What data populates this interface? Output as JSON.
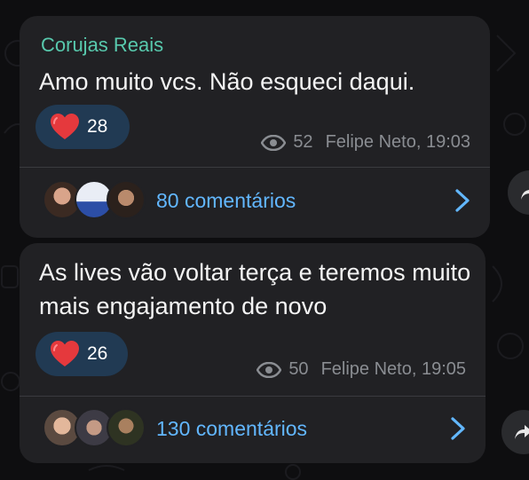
{
  "messages": [
    {
      "author": "Corujas Reais",
      "text": "Amo muito vcs. Não esqueci daqui.",
      "reaction": {
        "icon": "heart-icon",
        "count": "28"
      },
      "views": "52",
      "signature": "Felipe Neto, 19:03",
      "comments_label": "80 comentários"
    },
    {
      "author": "",
      "text": "As lives vão voltar terça e teremos muito mais engajamento de novo",
      "reaction": {
        "icon": "heart-icon",
        "count": "26"
      },
      "views": "50",
      "signature": "Felipe Neto, 19:05",
      "comments_label": "130 comentários"
    }
  ],
  "colors": {
    "author": "#58c9ad",
    "link": "#62b7ff",
    "reaction_bg": "#213a53",
    "heart": "#e5393d",
    "bubble": "#212124"
  }
}
